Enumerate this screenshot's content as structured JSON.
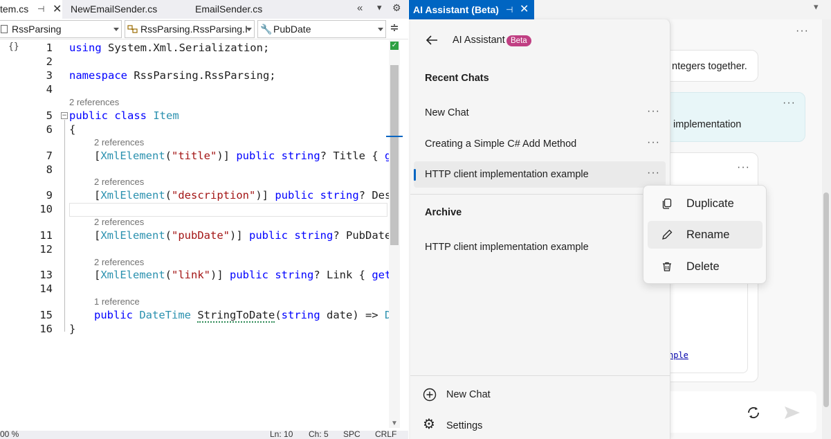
{
  "editor": {
    "tabs": [
      {
        "label": "tem.cs",
        "active": true
      },
      {
        "label": "NewEmailSender.cs"
      },
      {
        "label": "EmailSender.cs"
      }
    ],
    "nav": {
      "project": "RssParsing",
      "type": "RssParsing.RssParsing.I",
      "member": "PubDate"
    },
    "line_numbers": [
      "1",
      "2",
      "3",
      "4",
      "5",
      "6",
      "7",
      "8",
      "9",
      "10",
      "11",
      "12",
      "13",
      "14",
      "15",
      "16"
    ],
    "references": {
      "r2": "2 references",
      "r1": "1 reference"
    },
    "code": {
      "l1_kw": "using",
      "l1_rest": " System.Xml.Serialization;",
      "l3_kw": "namespace",
      "l3_rest": " RssParsing.RssParsing;",
      "l5_kw": "public class ",
      "l5_type": "Item",
      "l6": "{",
      "l7_a": "[",
      "l7_attr": "XmlElement",
      "l7_b": "(",
      "l7_str": "\"title\"",
      "l7_c": ")] ",
      "l7_kw": "public string",
      "l7_rest": "? Title { ",
      "l7_kw2": "ge",
      "l9_attr": "XmlElement",
      "l9_str": "\"description\"",
      "l9_kw": "public string",
      "l9_rest": "? Desc",
      "l11_attr": "XmlElement",
      "l11_str": "\"pubDate\"",
      "l11_kw": "public string",
      "l11_rest": "? PubDate",
      "l13_attr": "XmlElement",
      "l13_str": "\"link\"",
      "l13_kw": "public string",
      "l13_rest": "? Link { ",
      "l13_kw2": "get;",
      "l15_kw": "public ",
      "l15_type": "DateTime",
      "l15_method": "StringToDate",
      "l15_a": "(",
      "l15_kw2": "string",
      "l15_rest": " date) => ",
      "l15_type2": "Da",
      "l16": "}"
    },
    "status": {
      "zoom": "00 %",
      "line": "Ln: 10",
      "col": "Ch: 5",
      "spc": "SPC",
      "crlf": "CRLF"
    }
  },
  "ai": {
    "window_title": "AI Assistant (Beta)",
    "header_title": "AI Assistant",
    "beta_badge": "Beta",
    "recent_heading": "Recent Chats",
    "recent": [
      {
        "label": "New Chat",
        "more": "···"
      },
      {
        "label": "Creating a Simple C# Add Method",
        "more": "···"
      },
      {
        "label": "HTTP client implementation example",
        "more": "···",
        "selected": true
      }
    ],
    "archive_heading": "Archive",
    "archive": [
      {
        "label": "HTTP client implementation example"
      }
    ],
    "new_chat": "New Chat",
    "settings": "Settings",
    "chat_fragments": {
      "f1": "ntegers together.",
      "f2": "implementation",
      "f3": "nple"
    },
    "more": "···",
    "context_menu": {
      "duplicate": "Duplicate",
      "rename": "Rename",
      "delete": "Delete"
    },
    "colors": {
      "accent": "#0065c2",
      "badge": "#c03f83"
    }
  }
}
